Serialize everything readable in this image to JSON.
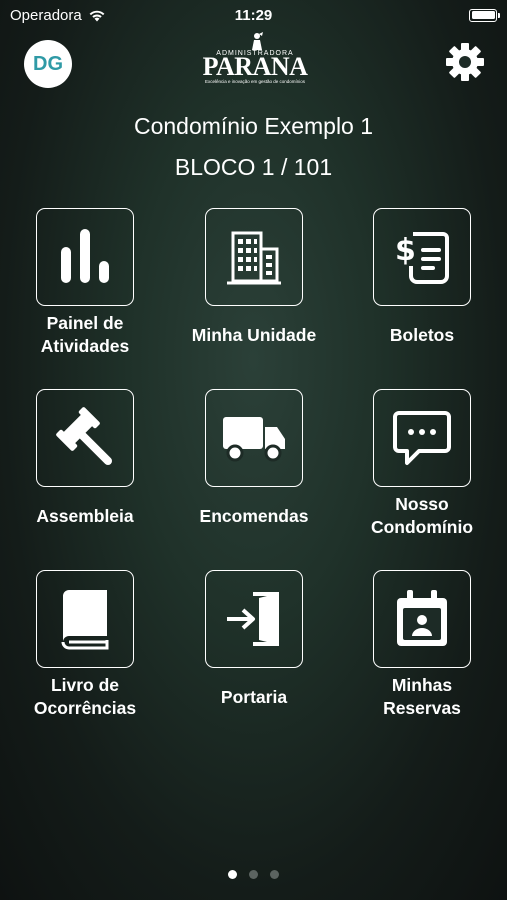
{
  "status_bar": {
    "carrier": "Operadora",
    "time": "11:29"
  },
  "header": {
    "avatar_initials": "DG",
    "logo": {
      "top": "ADMINISTRADORA",
      "main": "PARANA",
      "sub": "Excelência e inovação em gestão de condomínios"
    }
  },
  "condo": {
    "name": "Condomínio Exemplo 1",
    "unit": "BLOCO 1 / 101"
  },
  "menu": [
    {
      "label": "Painel de\nAtividades",
      "icon": "bar-chart-icon"
    },
    {
      "label": "Minha Unidade",
      "icon": "building-icon"
    },
    {
      "label": "Boletos",
      "icon": "invoice-icon"
    },
    {
      "label": "Assembleia",
      "icon": "gavel-icon"
    },
    {
      "label": "Encomendas",
      "icon": "truck-icon"
    },
    {
      "label": "Nosso\nCondomínio",
      "icon": "chat-bubble-icon"
    },
    {
      "label": "Livro de\nOcorrências",
      "icon": "book-icon"
    },
    {
      "label": "Portaria",
      "icon": "door-entry-icon"
    },
    {
      "label": "Minhas\nReservas",
      "icon": "calendar-user-icon"
    }
  ],
  "pagination": {
    "pages": 3,
    "current": 1
  },
  "colors": {
    "avatar_text": "#2f9aa6",
    "background": "#1f3129"
  }
}
